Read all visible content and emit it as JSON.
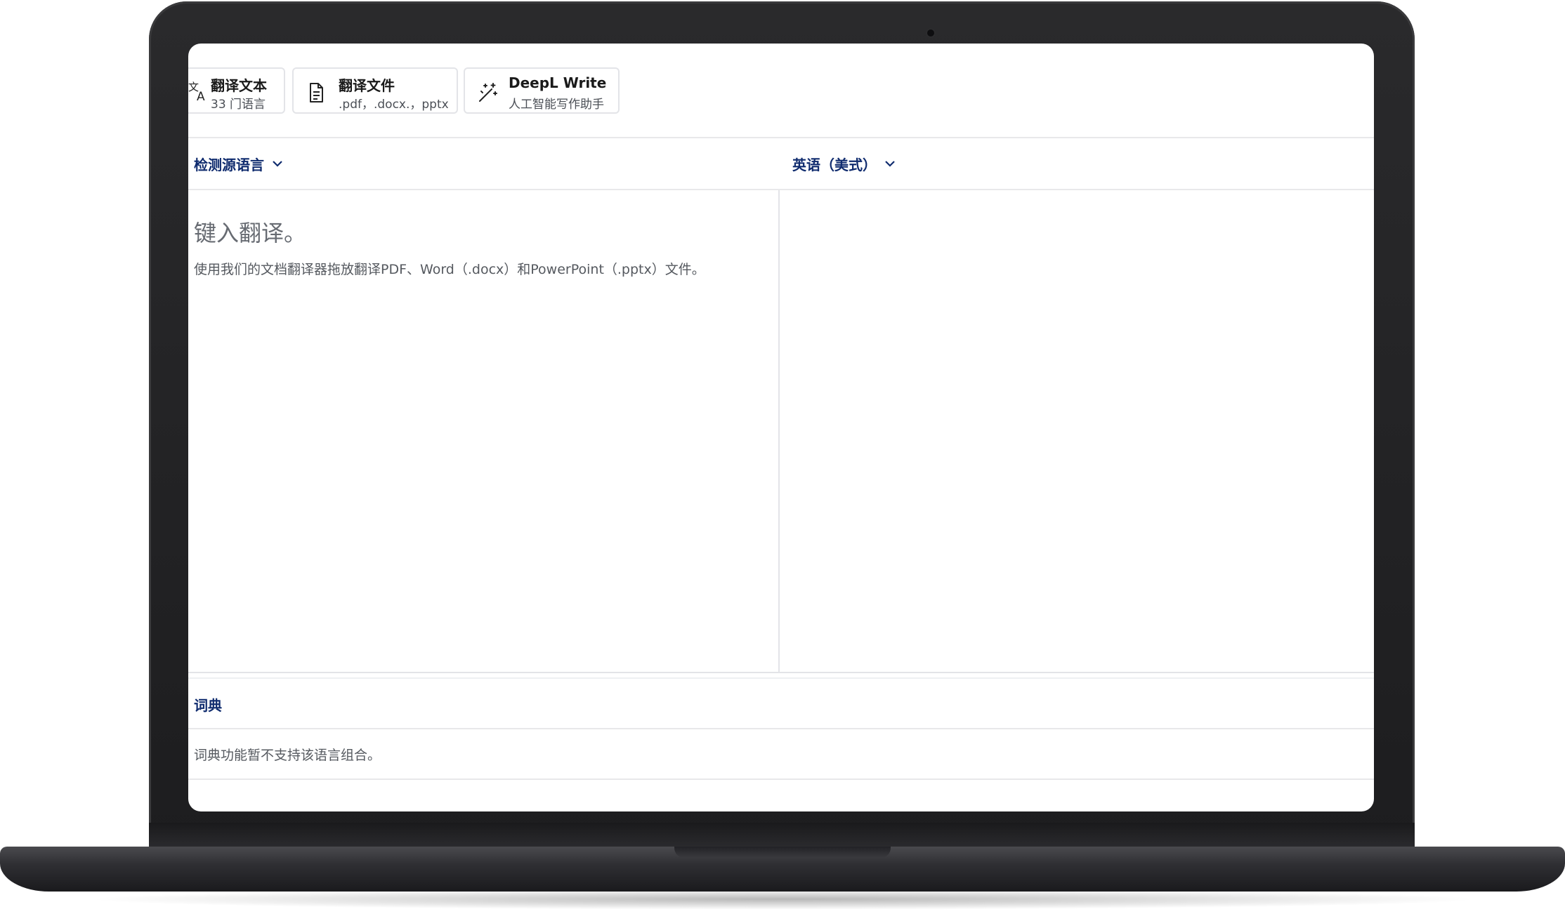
{
  "tabs": [
    {
      "title": "翻译文本",
      "subtitle": "33 门语言",
      "icon": "translate-icon"
    },
    {
      "title": "翻译文件",
      "subtitle": ".pdf，.docx.，pptx",
      "icon": "document-icon"
    },
    {
      "title": "DeepL Write",
      "subtitle": "人工智能写作助手",
      "icon": "magic-wand-icon"
    }
  ],
  "source_language": {
    "label": "检测源语言",
    "icon": "chevron-down-icon"
  },
  "target_language": {
    "label": "英语（美式）",
    "icon": "chevron-down-icon"
  },
  "source_input": {
    "placeholder": "键入翻译。",
    "hint": "使用我们的文档翻译器拖放翻译PDF、Word（.docx）和PowerPoint（.pptx）文件。"
  },
  "dictionary": {
    "title": "词典",
    "message": "词典功能暂不支持该语言组合。"
  },
  "colors": {
    "accent": "#0f2b6e",
    "border": "#e3e4e8",
    "bezel": "#1d1d1f"
  }
}
